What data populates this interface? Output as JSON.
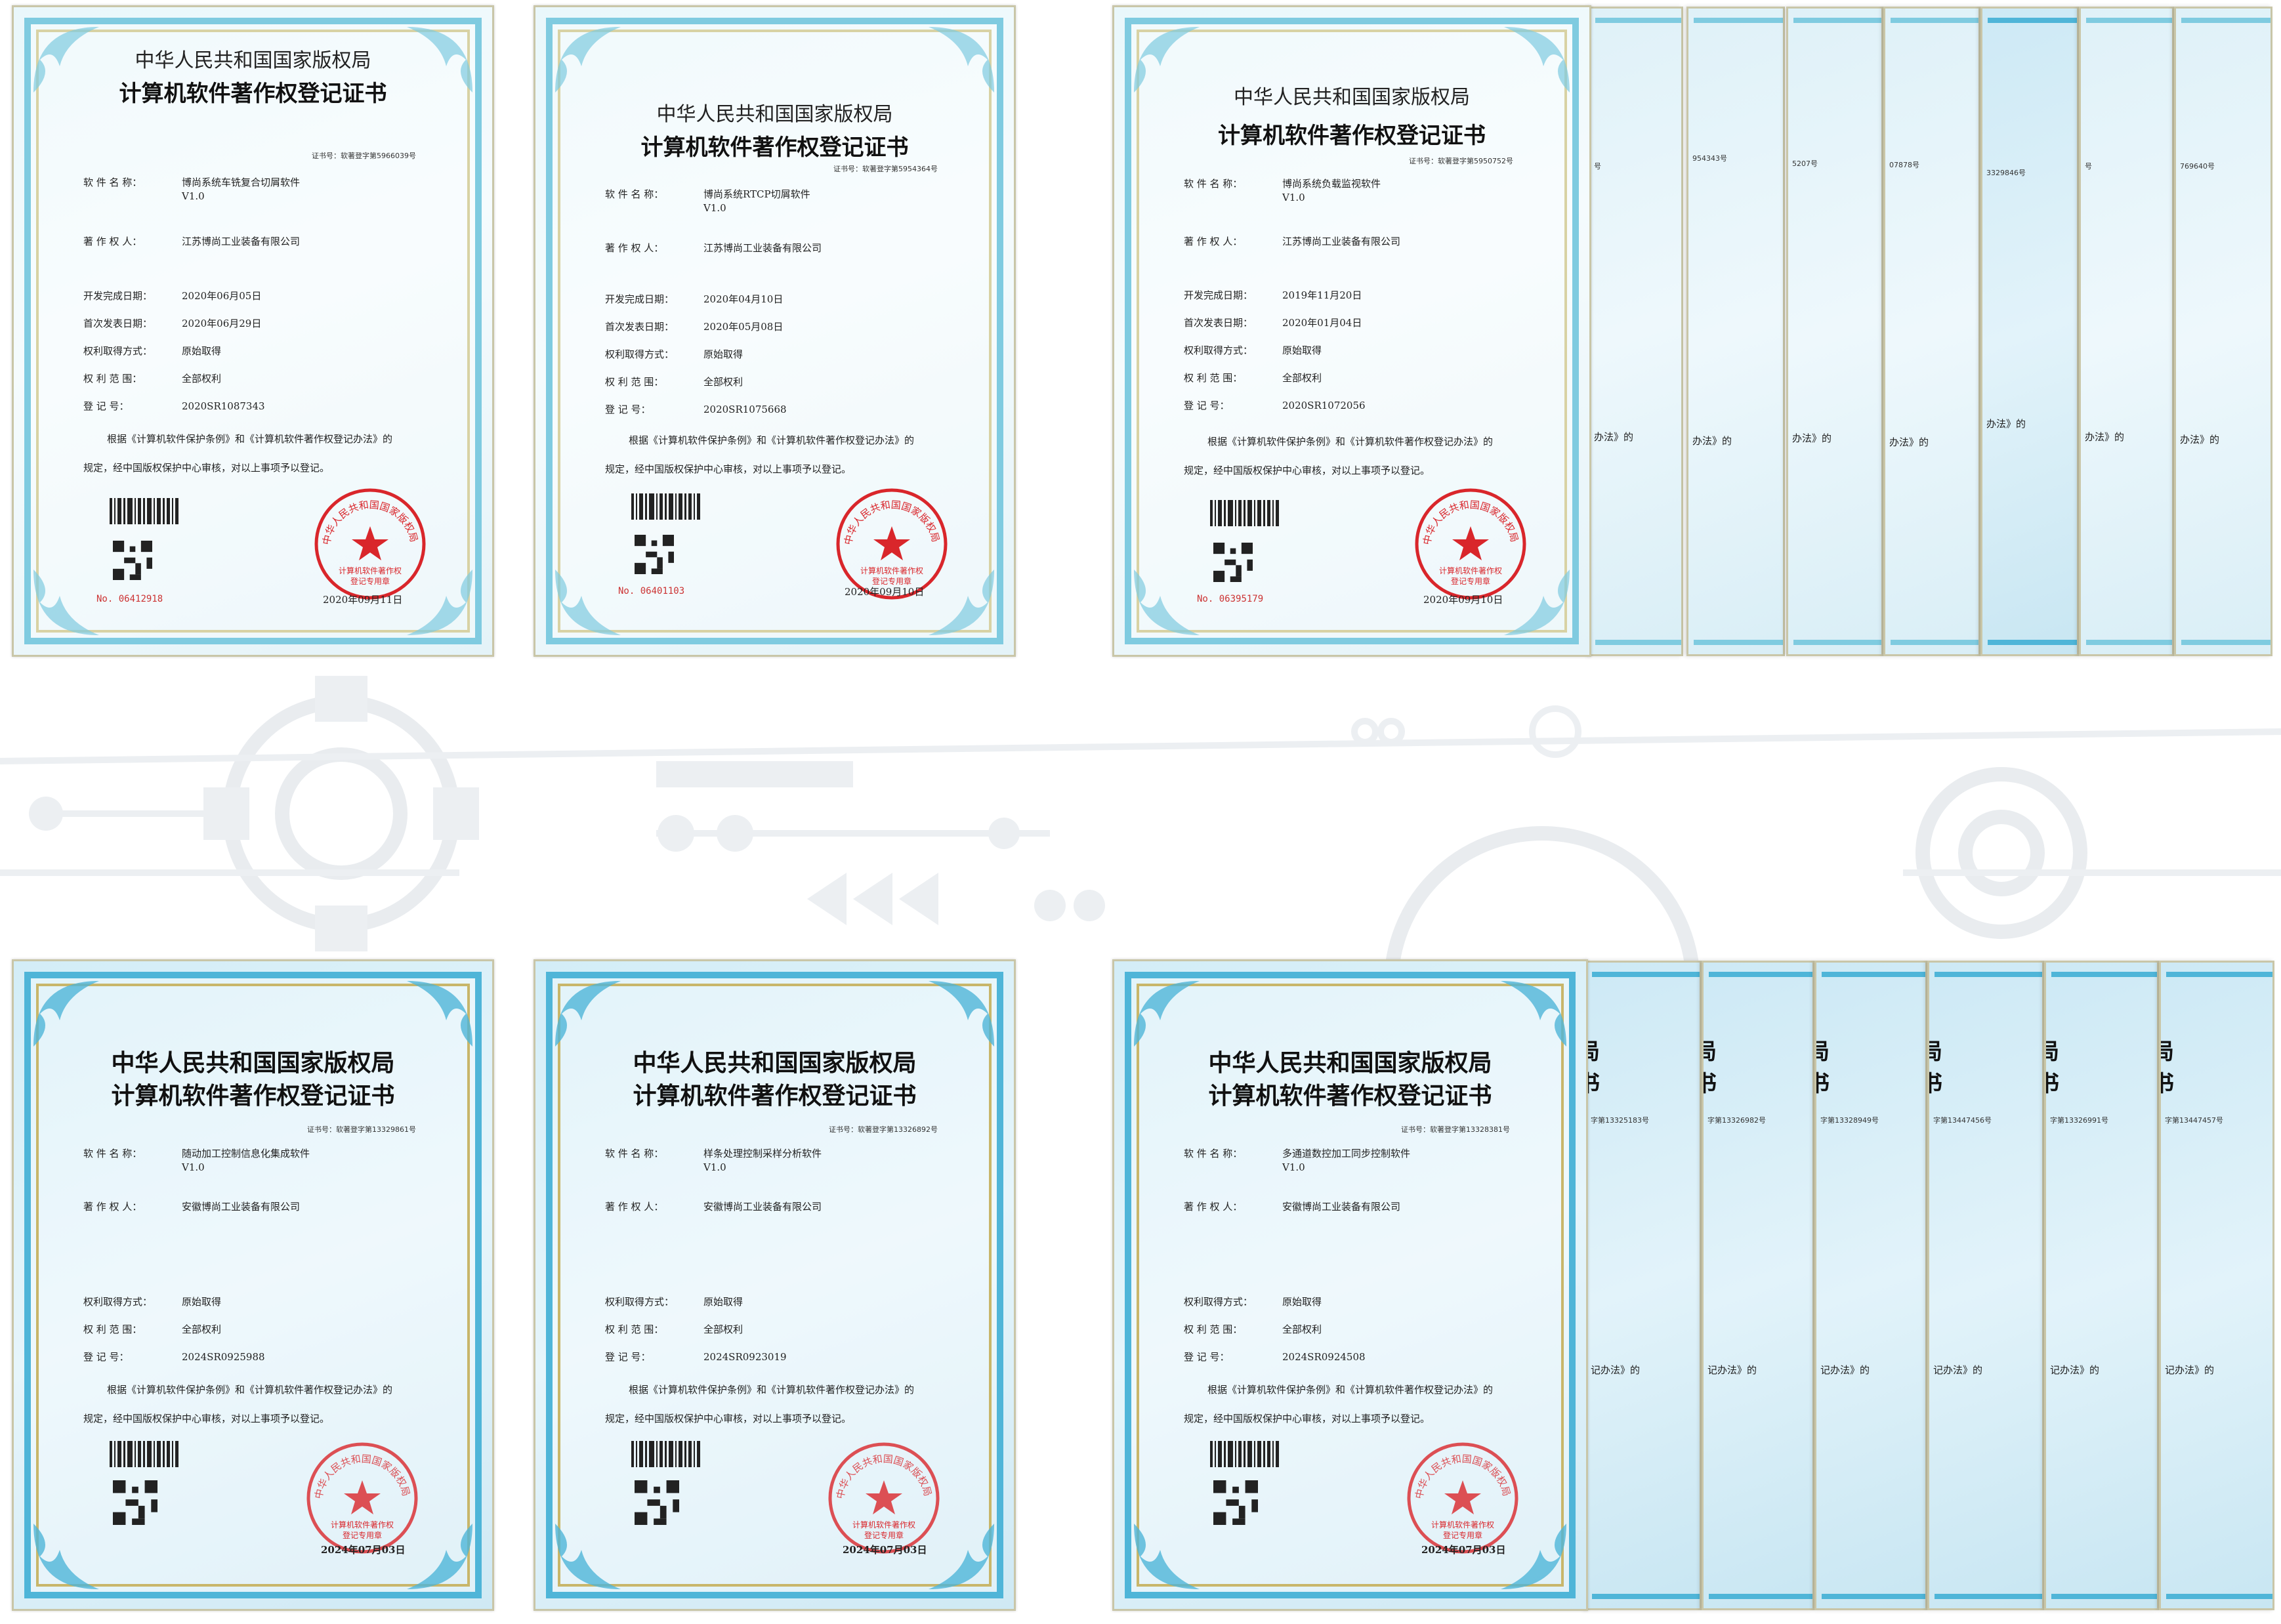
{
  "colors": {
    "seal_red": "#d9262b",
    "frame_blue": "#7fcbe0",
    "frame_blue_dark": "#4fb5d8",
    "gold": "#c8b66a"
  },
  "common": {
    "authority": "中华人民共和国国家版权局",
    "cert_title": "计算机软件著作权登记证书",
    "k_name": "软 件 名 称：",
    "k_owner": "著 作 权 人：",
    "k_devdate": "开发完成日期：",
    "k_pubdate": "首次发表日期：",
    "k_method": "权利取得方式：",
    "k_scope": "权 利 范 围：",
    "k_regno": "登     记     号：",
    "method": "原始取得",
    "scope": "全部权利",
    "para_line1": "根据《计算机软件保护条例》和《计算机软件著作权登记办法》的",
    "para_line2": "规定，经中国版权保护中心审核，对以上事项予以登记。",
    "serial_label": "No.",
    "seal_outer": "中华人民共和国国家版权局",
    "seal_inner1": "计算机软件著作权",
    "seal_inner2": "登记专用章"
  },
  "certificates": [
    {
      "cert_no": "证书号：软著登字第5966039号",
      "name": "博尚系统车铣复合切屑软件",
      "version": "V1.0",
      "owner": "江苏博尚工业装备有限公司",
      "dev_date": "2020年06月05日",
      "pub_date": "2020年06月29日",
      "reg_no": "2020SR1087343",
      "serial": "06412918",
      "issue_date": "2020年09月11日"
    },
    {
      "cert_no": "证书号：软著登字第5954364号",
      "name": "博尚系统RTCP切屑软件",
      "version": "V1.0",
      "owner": "江苏博尚工业装备有限公司",
      "dev_date": "2020年04月10日",
      "pub_date": "2020年05月08日",
      "reg_no": "2020SR1075668",
      "serial": "06401103",
      "issue_date": "2020年09月10日"
    },
    {
      "cert_no": "证书号：软著登字第5950752号",
      "name": "博尚系统负载监视软件",
      "version": "V1.0",
      "owner": "江苏博尚工业装备有限公司",
      "dev_date": "2019年11月20日",
      "pub_date": "2020年01月04日",
      "reg_no": "2020SR1072056",
      "serial": "06395179",
      "issue_date": "2020年09月10日"
    },
    {
      "cert_no": "证书号：软著登字第13329861号",
      "name": "随动加工控制信息化集成软件",
      "version": "V1.0",
      "owner": "安徽博尚工业装备有限公司",
      "reg_no": "2024SR0925988",
      "issue_date": "2024年07月03日"
    },
    {
      "cert_no": "证书号：软著登字第13326892号",
      "name": "样条处理控制采样分析软件",
      "version": "V1.0",
      "owner": "安徽博尚工业装备有限公司",
      "reg_no": "2024SR0923019",
      "issue_date": "2024年07月03日"
    },
    {
      "cert_no": "证书号：软著登字第13328381号",
      "name": "多通道数控加工同步控制软件",
      "version": "V1.0",
      "owner": "安徽博尚工业装备有限公司",
      "reg_no": "2024SR0924508",
      "issue_date": "2024年07月03日"
    }
  ],
  "stubs_top": [
    {
      "no": "号",
      "para": "办法》的"
    },
    {
      "no": "954343号",
      "para": "办法》的"
    },
    {
      "no": "5207号",
      "para": "办法》的"
    },
    {
      "no": "07878号",
      "para": "办法》的"
    },
    {
      "no": "3329846号",
      "para": "办法》的"
    },
    {
      "no": "号",
      "para": "办法》的"
    },
    {
      "no": "769640号",
      "para": "办法》的"
    }
  ],
  "stubs_bottom": [
    {
      "no": "字第13325183号",
      "para": "记办法》的"
    },
    {
      "no": "字第13326982号",
      "para": "记办法》的"
    },
    {
      "no": "字第13328949号",
      "para": "记办法》的"
    },
    {
      "no": "字第13447456号",
      "para": "记办法》的"
    },
    {
      "no": "字第13326991号",
      "para": "记办法》的"
    },
    {
      "no": "字第13447457号",
      "para": "记办法》的"
    }
  ]
}
